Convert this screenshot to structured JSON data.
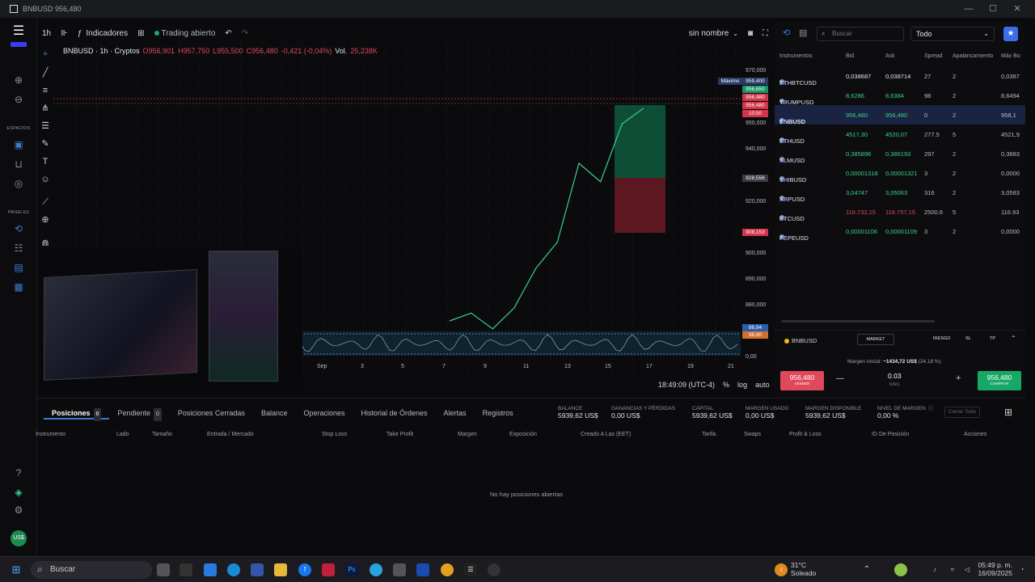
{
  "window": {
    "title": "BNBUSD 956,480"
  },
  "left_rail": {
    "labels": [
      "ESPACIOS",
      "PANELES"
    ],
    "account": "US$"
  },
  "toolbar": {
    "timeframe": "1h",
    "indicators": "Indicadores",
    "trading": "Trading abierto",
    "layout_name": "sin nombre"
  },
  "legend": {
    "symbol": "BNBUSD · 1h · Cryptos",
    "o": "O956,901",
    "h": "H957,750",
    "l": "L955,500",
    "c": "C956,480",
    "chg": "-0,421 (-0,04%)",
    "vol_label": "Vol.",
    "vol": "25,238K"
  },
  "y_axis": {
    "ticks": [
      "970,000",
      "960,000",
      "950,000",
      "940,000",
      "930,000",
      "920,000",
      "910,000",
      "900,000",
      "890,000",
      "880,000"
    ],
    "tags": [
      {
        "text": "Máximo",
        "color": "#2a3a66"
      },
      {
        "text": "959,400",
        "color": "#2a3a66"
      },
      {
        "text": "956,650",
        "color": "#16966a"
      },
      {
        "text": "956,480",
        "color": "#d2354a"
      },
      {
        "text": "956,480",
        "color": "#d2354a"
      },
      {
        "text": "10:50",
        "color": "#d2354a"
      },
      {
        "text": "928,556",
        "color": "#3a3d46"
      },
      {
        "text": "908,153",
        "color": "#d2354a"
      }
    ],
    "osc_ticks": [
      "98,94",
      "98,90",
      "0,00"
    ]
  },
  "x_axis": {
    "ticks": [
      "Sep",
      "3",
      "5",
      "7",
      "9",
      "11",
      "13",
      "15",
      "17",
      "19",
      "21"
    ]
  },
  "status": {
    "clock": "18:49:09 (UTC-4)",
    "pct": "%",
    "log": "log",
    "auto": "auto"
  },
  "chart_data": {
    "type": "line",
    "title": "BNBUSD · 1h · Cryptos",
    "x": [
      "Sep",
      "3",
      "5",
      "7",
      "9",
      "11",
      "13",
      "15",
      "17",
      "19",
      "21"
    ],
    "series": [
      {
        "values": [
          875,
          878,
          872,
          880,
          895,
          905,
          935,
          928,
          950,
          956
        ]
      }
    ],
    "ylim": [
      875,
      975
    ]
  },
  "bottom": {
    "tabs": [
      {
        "label": "Posiciones",
        "badge": "0"
      },
      {
        "label": "Pendiente",
        "badge": "0"
      },
      {
        "label": "Posiciones Cerradas"
      },
      {
        "label": "Balance"
      },
      {
        "label": "Operaciones"
      },
      {
        "label": "Historial de Órdenes"
      },
      {
        "label": "Alertas"
      },
      {
        "label": "Registros"
      }
    ],
    "stats": [
      {
        "label": "BALANCE",
        "value": "5939,62 US$"
      },
      {
        "label": "GANANCIAS Y PÉRDIDAS",
        "value": "0,00 US$"
      },
      {
        "label": "CAPITAL",
        "value": "5939,62 US$"
      },
      {
        "label": "MARGEN USADO",
        "value": "0,00 US$"
      },
      {
        "label": "MARGEN DISPONIBLE",
        "value": "5939,62 US$"
      },
      {
        "label": "NIVEL DE MARGEN",
        "value": "0,00 %"
      }
    ],
    "close_all": "Cerrar Todo",
    "columns": [
      "Instrumento",
      "Lado",
      "Tamaño",
      "Entrada / Mercado",
      "Stop Loss",
      "Take Profit",
      "Margen",
      "Exposición",
      "Creado A Las (EET)",
      "Tarifa",
      "Swaps",
      "Profit & Loss",
      "ID De Posición",
      "Acciones"
    ],
    "empty": "No hay posiciones abiertas"
  },
  "right": {
    "search_placeholder": "Buscar",
    "filter": "Todo",
    "headers": [
      "Instrumentos",
      "Bid",
      "Ask",
      "Spread",
      "Apalancamiento",
      "Máx Bo"
    ],
    "rows": [
      {
        "name": "ETHBTCUSD",
        "bid": "0,038687",
        "ask": "0,038714",
        "spread": "27",
        "lev": "2",
        "max": "0,0387",
        "color": "#e2e5ec"
      },
      {
        "name": "TRUMPUSD",
        "bid": "8,6286",
        "ask": "8,6384",
        "spread": "98",
        "lev": "2",
        "max": "8,6494",
        "color": "#3ad189"
      },
      {
        "name": "BNBUSD",
        "bid": "956,480",
        "ask": "956,480",
        "spread": "0",
        "lev": "2",
        "max": "958,1",
        "color": "#3ad189"
      },
      {
        "name": "ETHUSD",
        "bid": "4517,30",
        "ask": "4520,07",
        "spread": "277.5",
        "lev": "5",
        "max": "4521,9",
        "color": "#3ad189"
      },
      {
        "name": "XLMUSD",
        "bid": "0,385896",
        "ask": "0,386193",
        "spread": "297",
        "lev": "2",
        "max": "0,3883",
        "color": "#3ad189"
      },
      {
        "name": "SHIBUSD",
        "bid": "0,00001318",
        "ask": "0,00001321",
        "spread": "3",
        "lev": "2",
        "max": "0,0000",
        "color": "#3ad189"
      },
      {
        "name": "XRPUSD",
        "bid": "3,04747",
        "ask": "3,05063",
        "spread": "316",
        "lev": "2",
        "max": "3,0583",
        "color": "#3ad189"
      },
      {
        "name": "BTCUSD",
        "bid": "116.732,15",
        "ask": "116.757,15",
        "spread": "2500.6",
        "lev": "5",
        "max": "116.93",
        "color": "#e0485c"
      },
      {
        "name": "PEPEUSD",
        "bid": "0,00001106",
        "ask": "0,00001109",
        "spread": "3",
        "lev": "2",
        "max": "0,0000",
        "color": "#3ad189"
      }
    ]
  },
  "order": {
    "symbol": "BNBUSD",
    "type": "MARKET",
    "riesgo": "RIESGO",
    "sl": "SL",
    "tp": "TP",
    "margin_label": "Margen Inicial:",
    "margin": "~1434,72 US$",
    "margin_pct": "(24,18 %)",
    "sell_price": "956,480",
    "sell": "VENDER",
    "qty": "0.03",
    "unit": "lotes",
    "buy_price": "956,480",
    "buy": "COMPRAR"
  },
  "taskbar": {
    "search": "Buscar",
    "weather_temp": "31°C",
    "weather": "Soleado",
    "time": "05:49 p. m.",
    "date": "16/09/2025",
    "weather_badge": "2"
  }
}
